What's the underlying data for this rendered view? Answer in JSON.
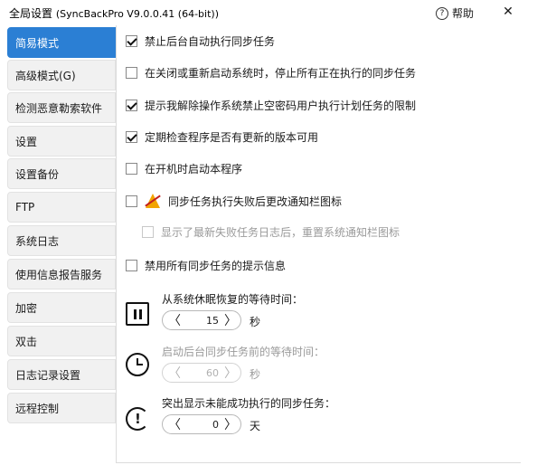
{
  "window": {
    "title_main": "全局设置",
    "title_sub": "(SyncBackPro V9.0.0.41 (64-bit))",
    "help_label": "帮助",
    "close_glyph": "✕"
  },
  "sidebar": {
    "items": [
      {
        "label": "简易模式",
        "active": true
      },
      {
        "label": "高级模式(G)"
      },
      {
        "label": "检测恶意勒索软件"
      },
      {
        "label": "设置"
      },
      {
        "label": "设置备份"
      },
      {
        "label": "FTP"
      },
      {
        "label": "系统日志"
      },
      {
        "label": "使用信息报告服务"
      },
      {
        "label": "加密"
      },
      {
        "label": "双击"
      },
      {
        "label": "日志记录设置"
      },
      {
        "label": "远程控制"
      }
    ]
  },
  "options": [
    {
      "label": "禁止后台自动执行同步任务",
      "checked": true
    },
    {
      "label": "在关闭或重新启动系统时，停止所有正在执行的同步任务",
      "checked": false
    },
    {
      "label": "提示我解除操作系统禁止空密码用户执行计划任务的限制",
      "checked": true
    },
    {
      "label": "定期检查程序是否有更新的版本可用",
      "checked": true
    },
    {
      "label": "在开机时启动本程序",
      "checked": false
    },
    {
      "label": "同步任务执行失败后更改通知栏图标",
      "checked": false,
      "icon": "warning-tray-icon"
    },
    {
      "label": "显示了最新失败任务日志后，重置系统通知栏图标",
      "checked": false,
      "disabled": true
    },
    {
      "label": "禁用所有同步任务的提示信息",
      "checked": false
    }
  ],
  "timers": [
    {
      "label": "从系统休眠恢复的等待时间：",
      "value": "15",
      "unit": "秒",
      "icon": "pause-icon",
      "disabled": false
    },
    {
      "label": "启动后台同步任务前的等待时间：",
      "value": "60",
      "unit": "秒",
      "icon": "clock-icon",
      "disabled": true
    },
    {
      "label": "突出显示未能成功执行的同步任务：",
      "value": "0",
      "unit": "天",
      "icon": "alert-refresh-icon",
      "disabled": false
    }
  ],
  "stepper_glyphs": {
    "left": "〈",
    "right": "〉"
  }
}
